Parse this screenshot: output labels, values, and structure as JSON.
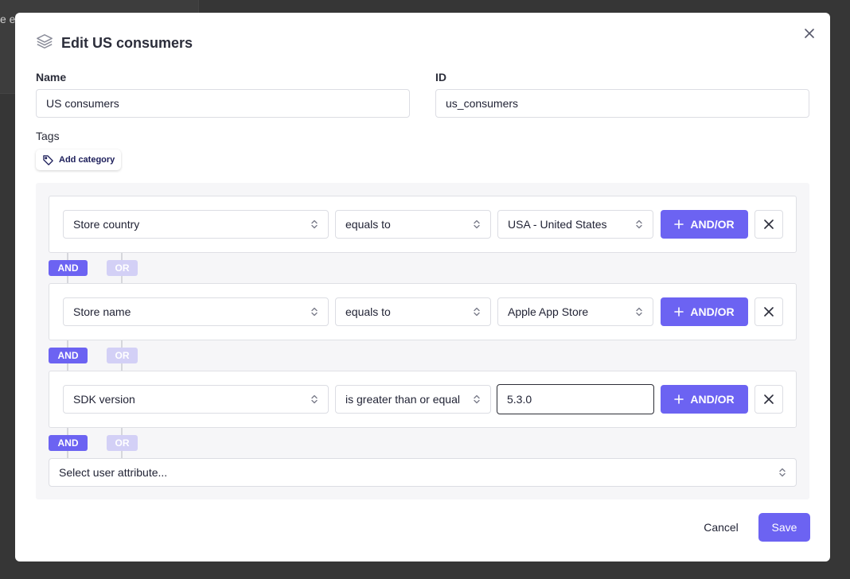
{
  "background": {
    "partial_text": "e e"
  },
  "modal": {
    "title": "Edit US consumers",
    "close_icon": "close-icon",
    "title_icon": "layers-icon"
  },
  "form": {
    "name_label": "Name",
    "name_value": "US consumers",
    "id_label": "ID",
    "id_value": "us_consumers",
    "tags_label": "Tags",
    "add_category_label": "Add category"
  },
  "rules": [
    {
      "attribute": "Store country",
      "operator": "equals to",
      "value": "USA - United States",
      "value_type": "select"
    },
    {
      "attribute": "Store name",
      "operator": "equals to",
      "value": "Apple App Store",
      "value_type": "select"
    },
    {
      "attribute": "SDK version",
      "operator": "is greater than or equal",
      "value": "5.3.0",
      "value_type": "input"
    }
  ],
  "rule_actions": {
    "andor_label": "AND/OR"
  },
  "connector": {
    "and_label": "AND",
    "or_label": "OR"
  },
  "attribute_select_placeholder": "Select user attribute...",
  "footer": {
    "cancel_label": "Cancel",
    "save_label": "Save"
  },
  "colors": {
    "accent": "#6c63f2",
    "accent_light": "#d3d0f6",
    "overlay": "#363636"
  }
}
